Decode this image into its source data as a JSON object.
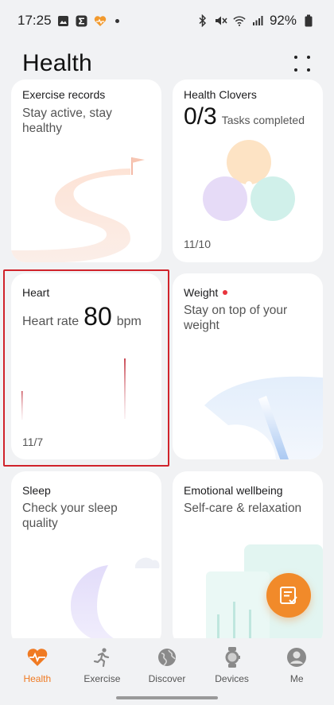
{
  "status_bar": {
    "time": "17:25",
    "battery": "92%",
    "icons": [
      "gallery-icon",
      "sigma-icon",
      "heart-app-icon",
      "bluetooth-icon",
      "mute-icon",
      "wifi-icon",
      "signal-icon",
      "battery-icon"
    ]
  },
  "header": {
    "title": "Health"
  },
  "cards": {
    "exercise": {
      "title": "Exercise records",
      "subtitle": "Stay active, stay healthy"
    },
    "clovers": {
      "title": "Health Clovers",
      "count": "0/3",
      "count_suffix": "Tasks completed",
      "date": "11/10"
    },
    "heart": {
      "title": "Heart",
      "rate_label": "Heart rate",
      "rate_value": "80",
      "rate_unit": "bpm",
      "date": "11/7"
    },
    "weight": {
      "title": "Weight",
      "subtitle": "Stay on top of your weight"
    },
    "sleep": {
      "title": "Sleep",
      "subtitle": "Check your sleep quality"
    },
    "emotional": {
      "title": "Emotional wellbeing",
      "subtitle": "Self-care & relaxation"
    }
  },
  "nav": {
    "items": [
      {
        "label": "Health",
        "icon": "heart-pulse-icon",
        "active": true
      },
      {
        "label": "Exercise",
        "icon": "runner-icon",
        "active": false
      },
      {
        "label": "Discover",
        "icon": "globe-icon",
        "active": false
      },
      {
        "label": "Devices",
        "icon": "watch-icon",
        "active": false
      },
      {
        "label": "Me",
        "icon": "person-icon",
        "active": false
      }
    ]
  },
  "colors": {
    "accent": "#f07a22",
    "highlight": "#d0232b",
    "heart_line": "#c94a55"
  }
}
